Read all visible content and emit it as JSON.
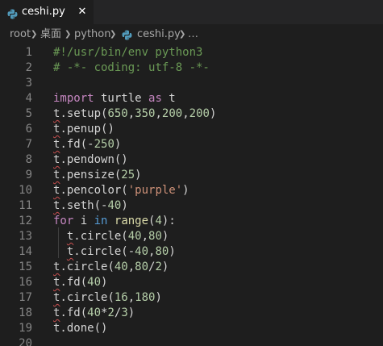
{
  "tab": {
    "label": "ceshi.py",
    "close_glyph": "✕",
    "icon": "python-file-icon"
  },
  "breadcrumb": {
    "items": [
      "root",
      "桌面",
      "python",
      "ceshi.py",
      "…"
    ],
    "separator_icon": "chevron-right-icon"
  },
  "editor": {
    "line_numbers": [
      "1",
      "2",
      "3",
      "4",
      "5",
      "6",
      "7",
      "8",
      "9",
      "10",
      "11",
      "12",
      "13",
      "14",
      "15",
      "16",
      "17",
      "18",
      "19",
      "20"
    ],
    "lines": [
      [
        {
          "t": "#!/usr/bin/env python3",
          "c": "cm"
        }
      ],
      [
        {
          "t": "# -*- coding: utf-8 -*-",
          "c": "cm"
        }
      ],
      [],
      [
        {
          "t": "import",
          "c": "kw"
        },
        {
          "t": " turtle ",
          "c": "pl"
        },
        {
          "t": "as",
          "c": "kw"
        },
        {
          "t": " t",
          "c": "pl"
        }
      ],
      [
        {
          "t": "t",
          "c": "t"
        },
        {
          "t": ".setup(",
          "c": "pl"
        },
        {
          "t": "650",
          "c": "num"
        },
        {
          "t": ",",
          "c": "pl"
        },
        {
          "t": "350",
          "c": "num"
        },
        {
          "t": ",",
          "c": "pl"
        },
        {
          "t": "200",
          "c": "num"
        },
        {
          "t": ",",
          "c": "pl"
        },
        {
          "t": "200",
          "c": "num"
        },
        {
          "t": ")",
          "c": "pl"
        }
      ],
      [
        {
          "t": "t",
          "c": "t"
        },
        {
          "t": ".penup()",
          "c": "pl"
        }
      ],
      [
        {
          "t": "t",
          "c": "t"
        },
        {
          "t": ".fd(-",
          "c": "pl"
        },
        {
          "t": "250",
          "c": "num"
        },
        {
          "t": ")",
          "c": "pl"
        }
      ],
      [
        {
          "t": "t",
          "c": "t"
        },
        {
          "t": ".pendown()",
          "c": "pl"
        }
      ],
      [
        {
          "t": "t",
          "c": "t"
        },
        {
          "t": ".pensize(",
          "c": "pl"
        },
        {
          "t": "25",
          "c": "num"
        },
        {
          "t": ")",
          "c": "pl"
        }
      ],
      [
        {
          "t": "t",
          "c": "t"
        },
        {
          "t": ".pencolor(",
          "c": "pl"
        },
        {
          "t": "'purple'",
          "c": "str"
        },
        {
          "t": ")",
          "c": "pl"
        }
      ],
      [
        {
          "t": "t",
          "c": "t"
        },
        {
          "t": ".seth(-",
          "c": "pl"
        },
        {
          "t": "40",
          "c": "num"
        },
        {
          "t": ")",
          "c": "pl"
        }
      ],
      [
        {
          "t": "for",
          "c": "kw"
        },
        {
          "t": " i ",
          "c": "pl"
        },
        {
          "t": "in",
          "c": "kw2"
        },
        {
          "t": " ",
          "c": "pl"
        },
        {
          "t": "range",
          "c": "fn"
        },
        {
          "t": "(",
          "c": "pl"
        },
        {
          "t": "4",
          "c": "num"
        },
        {
          "t": "):",
          "c": "pl"
        }
      ],
      [
        {
          "t": "  ",
          "c": "pl"
        },
        {
          "t": "t",
          "c": "t"
        },
        {
          "t": ".circle(",
          "c": "pl"
        },
        {
          "t": "40",
          "c": "num"
        },
        {
          "t": ",",
          "c": "pl"
        },
        {
          "t": "80",
          "c": "num"
        },
        {
          "t": ")",
          "c": "pl"
        }
      ],
      [
        {
          "t": "  ",
          "c": "pl"
        },
        {
          "t": "t",
          "c": "t"
        },
        {
          "t": ".circle(-",
          "c": "pl"
        },
        {
          "t": "40",
          "c": "num"
        },
        {
          "t": ",",
          "c": "pl"
        },
        {
          "t": "80",
          "c": "num"
        },
        {
          "t": ")",
          "c": "pl"
        }
      ],
      [
        {
          "t": "t",
          "c": "t"
        },
        {
          "t": ".circle(",
          "c": "pl"
        },
        {
          "t": "40",
          "c": "num"
        },
        {
          "t": ",",
          "c": "pl"
        },
        {
          "t": "80",
          "c": "num"
        },
        {
          "t": "/",
          "c": "pl"
        },
        {
          "t": "2",
          "c": "num"
        },
        {
          "t": ")",
          "c": "pl"
        }
      ],
      [
        {
          "t": "t",
          "c": "t"
        },
        {
          "t": ".fd(",
          "c": "pl"
        },
        {
          "t": "40",
          "c": "num"
        },
        {
          "t": ")",
          "c": "pl"
        }
      ],
      [
        {
          "t": "t",
          "c": "t"
        },
        {
          "t": ".circle(",
          "c": "pl"
        },
        {
          "t": "16",
          "c": "num"
        },
        {
          "t": ",",
          "c": "pl"
        },
        {
          "t": "180",
          "c": "num"
        },
        {
          "t": ")",
          "c": "pl"
        }
      ],
      [
        {
          "t": "t",
          "c": "t"
        },
        {
          "t": ".fd(",
          "c": "pl"
        },
        {
          "t": "40",
          "c": "num"
        },
        {
          "t": "*",
          "c": "pl"
        },
        {
          "t": "2",
          "c": "num"
        },
        {
          "t": "/",
          "c": "pl"
        },
        {
          "t": "3",
          "c": "num"
        },
        {
          "t": ")",
          "c": "pl"
        }
      ],
      [
        {
          "t": "t.done()",
          "c": "pl"
        }
      ],
      []
    ]
  }
}
